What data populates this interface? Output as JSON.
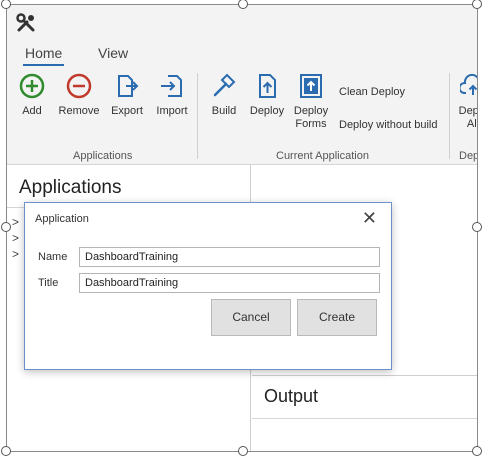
{
  "title_bar": {
    "icon": "wrench-icon"
  },
  "tabs": [
    {
      "label": "Home",
      "active": true
    },
    {
      "label": "View",
      "active": false
    }
  ],
  "ribbon": {
    "applications_group": {
      "label": "Applications",
      "buttons": [
        {
          "label": "Add",
          "icon": "add-circle-icon",
          "color": "#2e8b2e"
        },
        {
          "label": "Remove",
          "icon": "remove-circle-icon",
          "color": "#c0392b"
        },
        {
          "label": "Export",
          "icon": "export-icon",
          "color": "#2b6cb0"
        },
        {
          "label": "Import",
          "icon": "import-icon",
          "color": "#2b6cb0"
        }
      ]
    },
    "current_application_group": {
      "label": "Current Application",
      "buttons": [
        {
          "label": "Build",
          "icon": "hammer-icon"
        },
        {
          "label": "Deploy",
          "icon": "deploy-icon"
        },
        {
          "label_line1": "Deploy",
          "label_line2": "Forms",
          "icon": "deploy-forms-icon"
        }
      ],
      "small_buttons": [
        {
          "label": "Clean Deploy"
        },
        {
          "label": "Deploy without build"
        }
      ]
    },
    "deploy_all_group": {
      "label": "Depl",
      "button": {
        "label_line1": "Deplo",
        "label_line2": "All",
        "icon": "deploy-all-icon"
      }
    }
  },
  "left_panel": {
    "title": "Applications",
    "expanders": [
      ">",
      ">",
      ">"
    ]
  },
  "output_panel": {
    "title": "Output"
  },
  "dialog": {
    "title": "Application",
    "close": "✕",
    "fields": [
      {
        "label": "Name",
        "value": "DashboardTraining"
      },
      {
        "label": "Title",
        "value": "DashboardTraining"
      }
    ],
    "cancel_label": "Cancel",
    "create_label": "Create"
  },
  "colors": {
    "accent": "#2b6cb0",
    "add": "#2e8b2e",
    "remove": "#c0392b",
    "ribbon_bg": "#f3f3f3"
  }
}
